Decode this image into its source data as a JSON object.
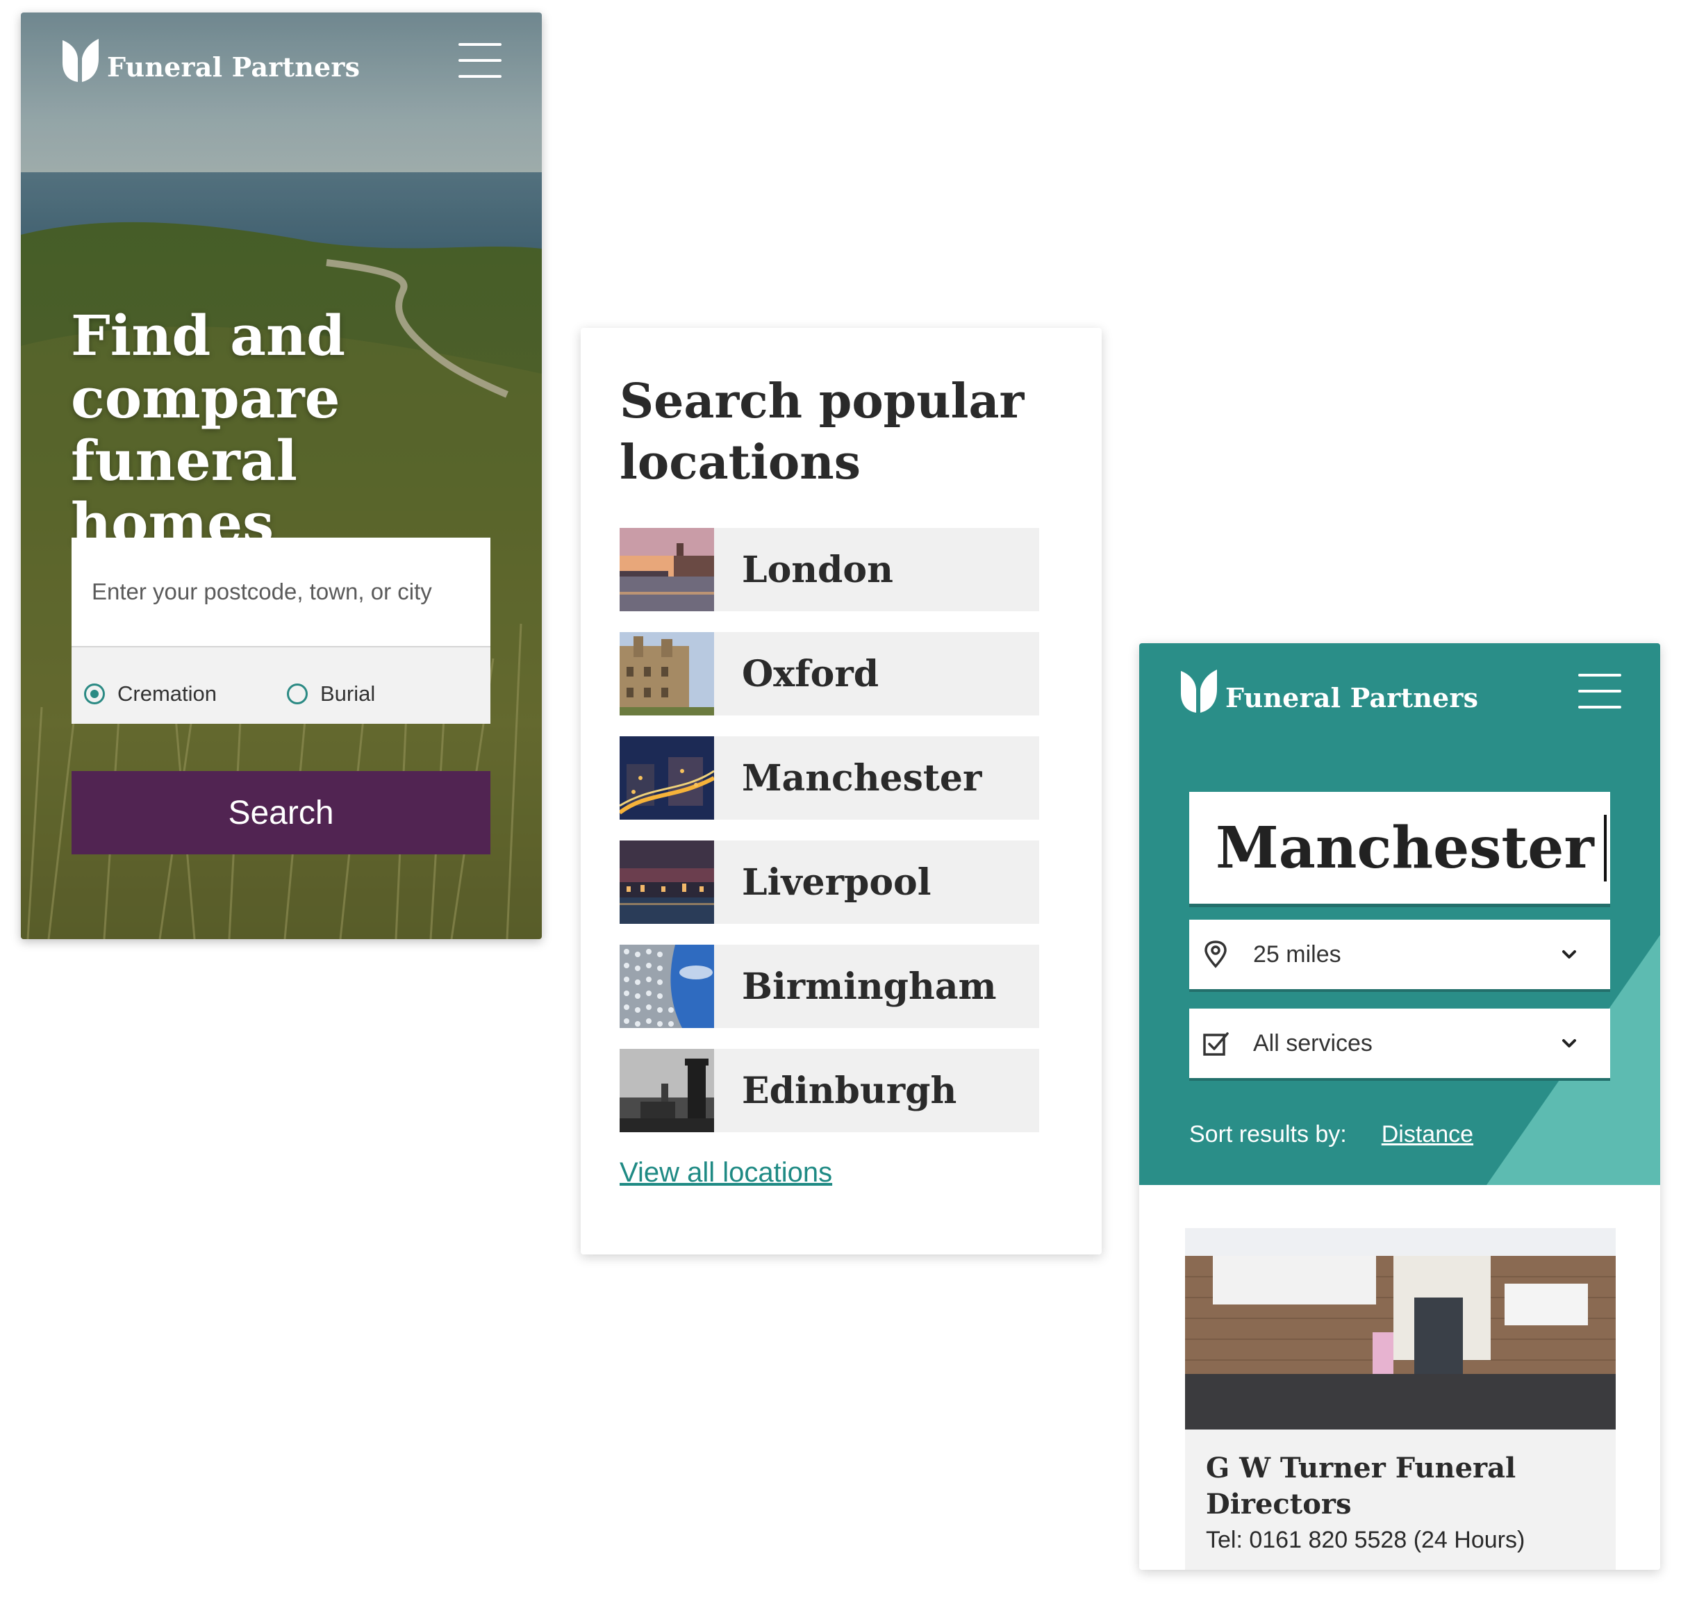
{
  "brand": {
    "name": "Funeral Partners",
    "teal": "#2a8e88",
    "purple": "#512452",
    "link": "#1f8a84"
  },
  "hero": {
    "title": "Find and compare funeral homes",
    "search_placeholder": "Enter your postcode, town, or city",
    "options": [
      {
        "label": "Cremation",
        "selected": true
      },
      {
        "label": "Burial",
        "selected": false
      }
    ],
    "search_button": "Search",
    "menu_icon": "hamburger-menu-icon"
  },
  "locations": {
    "title": "Search popular locations",
    "items": [
      {
        "name": "London"
      },
      {
        "name": "Oxford"
      },
      {
        "name": "Manchester"
      },
      {
        "name": "Liverpool"
      },
      {
        "name": "Birmingham"
      },
      {
        "name": "Edinburgh"
      }
    ],
    "view_all": "View all locations"
  },
  "results": {
    "query": "Manchester",
    "distance": "25 miles",
    "services": "All services",
    "sort_label": "Sort results by:",
    "sort_value": "Distance",
    "cards": [
      {
        "name": "G W Turner Funeral Directors",
        "tel": "Tel: 0161 820 5528 (24 Hours)"
      }
    ]
  }
}
